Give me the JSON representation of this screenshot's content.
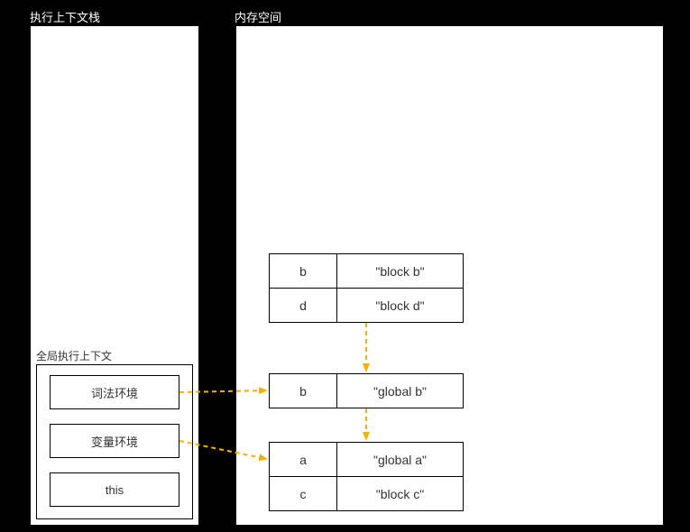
{
  "titles": {
    "stack": "执行上下文栈",
    "heap": "内存空间"
  },
  "globalContext": {
    "frameTitle": "全局执行上下文",
    "boxes": {
      "lexicalEnv": "词法环境",
      "variableEnv": "变量环境",
      "thisBinding": "this"
    }
  },
  "memory": {
    "blockScope": [
      {
        "key": "b",
        "value": "\"block b\""
      },
      {
        "key": "d",
        "value": "\"block d\""
      }
    ],
    "globalLexical": [
      {
        "key": "b",
        "value": "\"global b\""
      }
    ],
    "globalVariable": [
      {
        "key": "a",
        "value": "\"global a\""
      },
      {
        "key": "c",
        "value": "\"block c\""
      }
    ]
  }
}
